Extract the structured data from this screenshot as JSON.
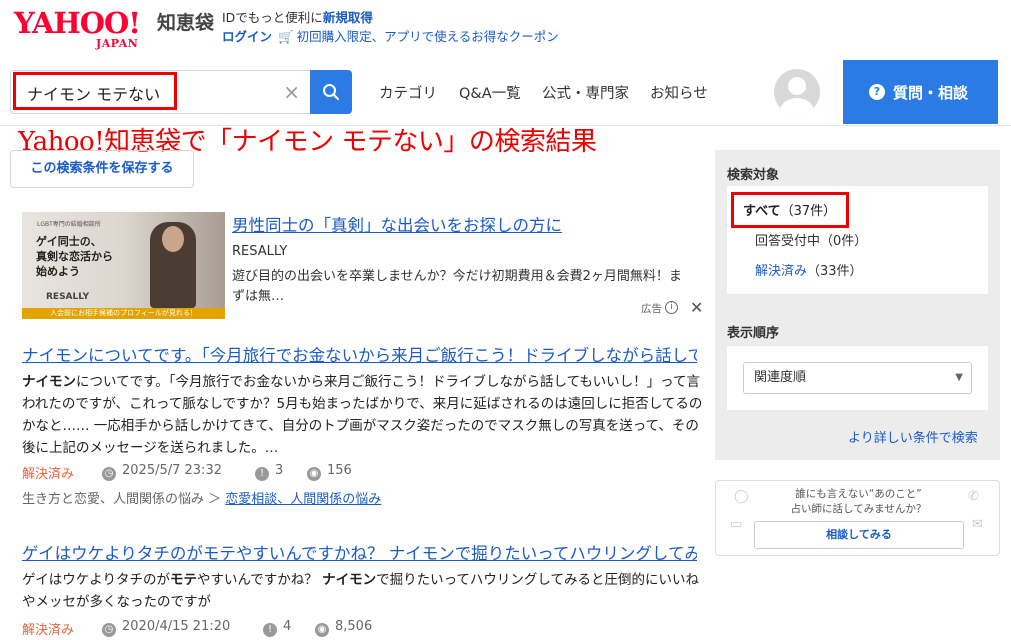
{
  "header": {
    "brand_yahoo": "YAHOO!",
    "brand_japan": "JAPAN",
    "service": "知恵袋",
    "account_line1_prefix": "IDでもっと便利に",
    "account_line1_link": "新規取得",
    "login": "ログイン",
    "promo": "初回購入限定、アプリで使えるお得なクーポン"
  },
  "search": {
    "value": "ナイモン モテない",
    "clear": "×"
  },
  "nav": {
    "items": [
      "カテゴリ",
      "Q&A一覧",
      "公式・専門家",
      "お知らせ"
    ],
    "ask_button": "質問・相談"
  },
  "overlay_title": "Yahoo!知恵袋で「ナイモン モテない」の検索結果",
  "save_search": "この検索条件を保存する",
  "ad": {
    "image_tiny": "LGBT専門の結婚相談所",
    "image_copy": [
      "ゲイ同士の、",
      "真剣な恋活から",
      "始めよう"
    ],
    "image_brand": "RESALLY",
    "image_strip": "入会前にお相手候補のプロフィールが見れる！",
    "title": "男性同士の「真剣」な出会いをお探しの方に",
    "sponsor": "RESALLY",
    "description": "遊び目的の出会いを卒業しませんか？今だけ初期費用＆会費2ヶ月間無料！まずは無…",
    "label": "広告",
    "close": "✕"
  },
  "results": [
    {
      "title": "ナイモンについてです。「今月旅行でお金ないから来月ご飯行こう！ドライブしながら話しても…",
      "snippet_bold": "ナイモン",
      "snippet_rest": "についてです。「今月旅行でお金ないから来月ご飯行こう！ドライブしながら話してもいいし！」って言われたのですが、これって脈なしですか？5月も始まったばかりで、来月に延ばされるのは遠回しに拒否してるのかなと…… 一応相手から話しかけてきて、自分のトプ画がマスク姿だったのでマスク無しの写真を送って、その後に上記のメッセージを送られました。…",
      "status": "解決済み",
      "date": "2025/5/7 23:32",
      "answers": "3",
      "views": "156",
      "category_parent": "生き方と恋愛、人間関係の悩み",
      "category_child": "恋愛相談、人間関係の悩み"
    },
    {
      "title": "ゲイはウケよりタチのがモテやすいんですかね？ ナイモンで掘りたいってハウリングしてみると…",
      "snippet_pre": "ゲイはウケよりタチのが",
      "snippet_bold1": "モテ",
      "snippet_mid": "やすいんですかね？ ",
      "snippet_bold2": "ナイモン",
      "snippet_rest": "で掘りたいってハウリングしてみると圧倒的にいいねやメッセが多くなったのですが",
      "status": "解決済み",
      "date": "2020/4/15 21:20",
      "answers": "4",
      "views": "8,506"
    }
  ],
  "sidebar": {
    "target_heading": "検索対象",
    "all": "すべて",
    "all_count": "（37件）",
    "open": "回答受付中（0件）",
    "solved": "解決済み",
    "solved_count": "（33件）",
    "sort_heading": "表示順序",
    "sort_value": "関連度順",
    "advanced": "より詳しい条件で検索"
  },
  "fortune": {
    "line1": "誰にも言えない“あのこと”",
    "line2": "占い師に話してみませんか？",
    "button": "相談してみる"
  },
  "colors": {
    "brand_red": "#ff0033",
    "link_blue": "#1a5bc4",
    "primary_button": "#2c7be5",
    "solved_orange": "#e8643a",
    "annotation_red": "#e00"
  }
}
